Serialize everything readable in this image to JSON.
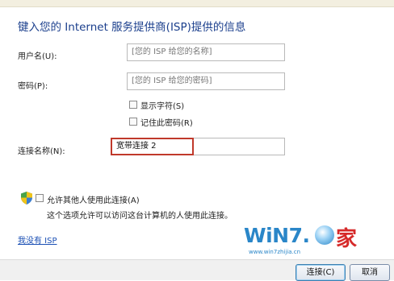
{
  "title": "键入您的 Internet 服务提供商(ISP)提供的信息",
  "form": {
    "username_label": "用户名(U):",
    "username_placeholder": "[您的 ISP 给您的名称]",
    "password_label": "密码(P):",
    "password_placeholder": "[您的 ISP 给您的密码]",
    "show_chars_label": "显示字符(S)",
    "show_chars_checked": false,
    "remember_password_label": "记住此密码(R)",
    "remember_password_checked": false,
    "connection_name_label": "连接名称(N):",
    "connection_name_value": "宽带连接 2"
  },
  "allow_others": {
    "label": "允许其他人使用此连接(A)",
    "checked": false,
    "hint": "这个选项允许可以访问这台计算机的人使用此连接。",
    "icon": "shield-icon"
  },
  "no_isp_link": "我没有 ISP",
  "watermark": {
    "brand": "WiN7.",
    "char": "家",
    "url": "www.win7zhijia.cn"
  },
  "buttons": {
    "connect": "连接(C)",
    "cancel": "取消"
  },
  "colors": {
    "title": "#1a3e8c",
    "link": "#1a4fb4",
    "highlight_border": "#c0392b"
  }
}
